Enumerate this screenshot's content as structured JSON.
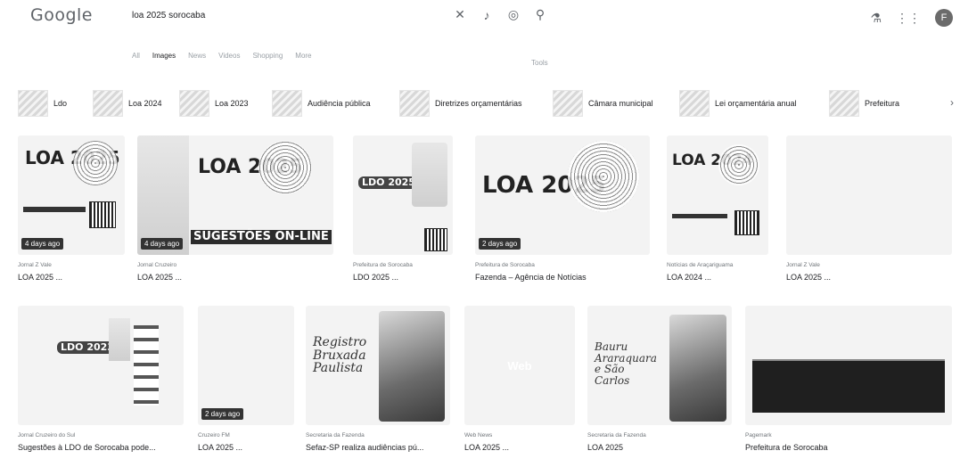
{
  "header": {
    "logo": "Google",
    "query": "loa 2025 sorocaba",
    "icons": [
      "close-icon",
      "mic-icon",
      "lens-icon",
      "search-icon"
    ],
    "right_icons": [
      "labs-icon",
      "apps-icon"
    ],
    "avatar_letter": "F"
  },
  "tabs": [
    "All",
    "Images",
    "News",
    "Videos",
    "Shopping",
    "More"
  ],
  "tools_label": "Tools",
  "chips": [
    {
      "label": "Ldo"
    },
    {
      "label": "Loa 2024"
    },
    {
      "label": "Loa 2023"
    },
    {
      "label": "Audiência pública"
    },
    {
      "label": "Diretrizes orçamentárias"
    },
    {
      "label": "Câmara municipal"
    },
    {
      "label": "Lei orçamentária anual"
    },
    {
      "label": "Prefeitura"
    }
  ],
  "row1": [
    {
      "source": "Jornal Z Vale",
      "caption": "LOA 2025 ...",
      "badge": "4 days ago",
      "poster_title": "LOA 2025"
    },
    {
      "source": "Jornal Cruzeiro",
      "caption": "LOA 2025 ...",
      "badge": "4 days ago",
      "poster_title": "LOA 2025",
      "poster_sub": "SUGESTÕES ON-LINE"
    },
    {
      "source": "Prefeitura de Sorocaba",
      "caption": "LDO 2025 ...",
      "poster_title": "LDO 2025"
    },
    {
      "source": "Prefeitura de Sorocaba",
      "caption": "Fazenda – Agência de Notícias",
      "badge": "2 days ago",
      "poster_title": "LOA 2025"
    },
    {
      "source": "Notícias de Araçariguama",
      "caption": "LOA 2024 ...",
      "poster_title": "LOA 2024"
    },
    {
      "source": "Jornal Z Vale",
      "caption": "LOA 2025 ..."
    }
  ],
  "row2": [
    {
      "source": "Jornal Cruzeiro do Sul",
      "caption": "Sugestões à LDO de Sorocaba pode...",
      "poster_title": "LDO 2023"
    },
    {
      "source": "Cruzeiro FM",
      "caption": "LOA 2025 ...",
      "badge": "2 days ago"
    },
    {
      "source": "Secretaria da Fazenda",
      "caption": "Sefaz-SP realiza audiências pú...",
      "script": "Registro Bruxada Paulista"
    },
    {
      "source": "Web News",
      "caption": "LOA 2025 ...",
      "web_label": "Web"
    },
    {
      "source": "Secretaria da Fazenda",
      "caption": "LOA 2025",
      "script": "Bauru Araraquara e São Carlos"
    },
    {
      "source": "Pagemark",
      "caption": "Prefeitura de Sorocaba"
    }
  ]
}
